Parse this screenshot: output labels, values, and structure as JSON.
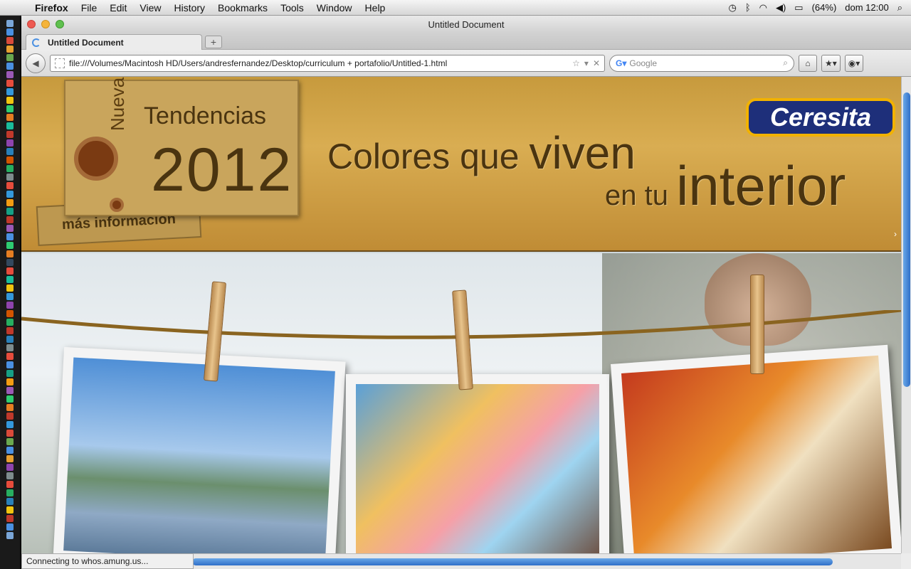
{
  "menubar": {
    "app_name": "Firefox",
    "items": [
      "File",
      "Edit",
      "View",
      "History",
      "Bookmarks",
      "Tools",
      "Window",
      "Help"
    ],
    "battery": "(64%)",
    "clock": "dom 12:00"
  },
  "window": {
    "title": "Untitled Document"
  },
  "tab": {
    "label": "Untitled Document",
    "new_tab": "+"
  },
  "navbar": {
    "url": "file:///Volumes/Macintosh HD/Users/andresfernandez/Desktop/curriculum + portafolio/Untitled-1.html",
    "search_placeholder": "Google"
  },
  "banner": {
    "vertical_word": "Nuevas",
    "tendencias": "Tendencias",
    "year": "2012",
    "more_info": "más información",
    "slogan_a": "Colores que",
    "slogan_b": "viven",
    "slogan_c": "en tu",
    "slogan_d": "interior",
    "brand": "Ceresita"
  },
  "status": {
    "text": "Connecting to whos.amung.us..."
  },
  "colors": {
    "accent": "#2f6fc8",
    "brand_blue": "#1e2f7a",
    "brand_yellow": "#f2b200"
  }
}
